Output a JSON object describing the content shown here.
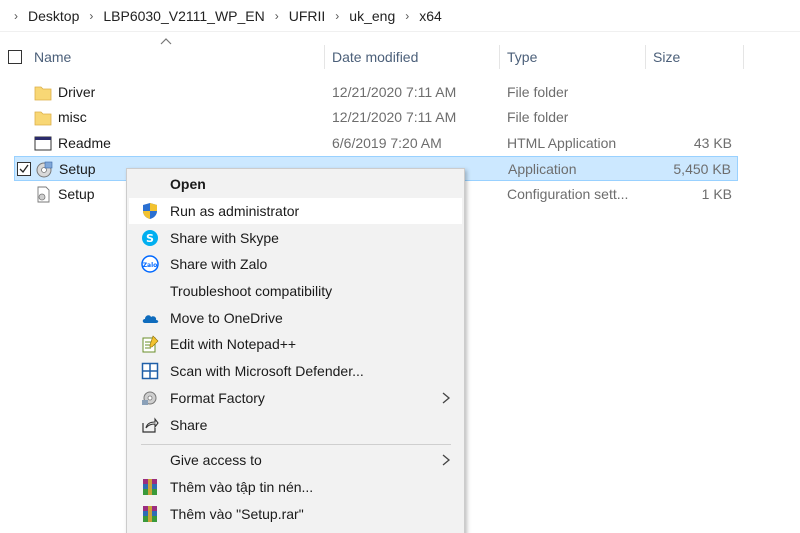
{
  "breadcrumb": [
    "Desktop",
    "LBP6030_V2111_WP_EN",
    "UFRII",
    "uk_eng",
    "x64"
  ],
  "columns": {
    "name": "Name",
    "date": "Date modified",
    "type": "Type",
    "size": "Size"
  },
  "files": [
    {
      "name": "Driver",
      "date": "12/21/2020 7:11 AM",
      "type": "File folder",
      "size": "",
      "icon": "folder-icon"
    },
    {
      "name": "misc",
      "date": "12/21/2020 7:11 AM",
      "type": "File folder",
      "size": "",
      "icon": "folder-icon"
    },
    {
      "name": "Readme",
      "date": "6/6/2019 7:20 AM",
      "type": "HTML Application",
      "size": "43 KB",
      "icon": "html-application-icon"
    },
    {
      "name": "Setup",
      "date": "",
      "type": "Application",
      "size": "5,450 KB",
      "icon": "setup-application-icon"
    },
    {
      "name": "Setup",
      "date": "",
      "type": "Configuration sett...",
      "size": "1 KB",
      "icon": "config-file-icon"
    }
  ],
  "context_menu": {
    "items": [
      {
        "label": "Open",
        "icon": ""
      },
      {
        "label": "Run as administrator",
        "icon": "uac-shield-icon"
      },
      {
        "label": "Share with Skype",
        "icon": "skype-icon"
      },
      {
        "label": "Share with Zalo",
        "icon": "zalo-icon"
      },
      {
        "label": "Troubleshoot compatibility",
        "icon": ""
      },
      {
        "label": "Move to OneDrive",
        "icon": "onedrive-icon"
      },
      {
        "label": "Edit with Notepad++",
        "icon": "notepad-plus-plus-icon"
      },
      {
        "label": "Scan with Microsoft Defender...",
        "icon": "defender-icon"
      },
      {
        "label": "Format Factory",
        "icon": "format-factory-icon"
      },
      {
        "label": "Share",
        "icon": "share-icon"
      },
      {
        "label": "Give access to",
        "icon": ""
      },
      {
        "label": "Thêm vào tập tin nén...",
        "icon": "winrar-icon"
      },
      {
        "label": "Thêm vào \"Setup.rar\"",
        "icon": "winrar-icon"
      }
    ]
  },
  "colors": {
    "selection": "#cce8ff",
    "selection_border": "#99d1ff",
    "folder": "#f8d775",
    "menu_bg": "#f2f2f2"
  }
}
